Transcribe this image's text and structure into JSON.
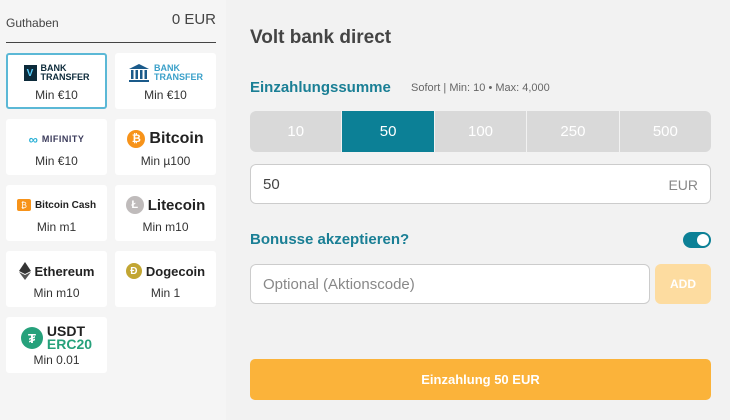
{
  "balance": {
    "label": "Guthaben",
    "amount": "0 EUR"
  },
  "methods": [
    {
      "id": "volt",
      "logo_line1": "BANK",
      "logo_line2": "TRANSFER",
      "min": "Min €10",
      "selected": true
    },
    {
      "id": "bank",
      "logo_line1": "BANK",
      "logo_line2": "TRANSFER",
      "min": "Min €10"
    },
    {
      "id": "mifinity",
      "logo": "MIFINITY",
      "min": "Min €10"
    },
    {
      "id": "bitcoin",
      "name": "Bitcoin",
      "min": "Min µ100"
    },
    {
      "id": "bitcoin-cash",
      "name": "Bitcoin Cash",
      "min": "Min m1"
    },
    {
      "id": "litecoin",
      "name": "Litecoin",
      "min": "Min m10"
    },
    {
      "id": "ethereum",
      "name": "Ethereum",
      "min": "Min m10"
    },
    {
      "id": "dogecoin",
      "name": "Dogecoin",
      "min": "Min 1"
    },
    {
      "id": "usdt",
      "name_line1": "USDT",
      "name_line2": "ERC20",
      "min": "Min 0.01"
    }
  ],
  "main": {
    "title": "Volt bank direct",
    "amount_section": {
      "label": "Einzahlungssumme",
      "info": "Sofort | Min: 10 • Max: 4,000"
    },
    "amount_options": [
      "10",
      "50",
      "100",
      "250",
      "500"
    ],
    "selected_amount": "50",
    "amount_input": {
      "value": "50",
      "currency": "EUR"
    },
    "bonus": {
      "label": "Bonusse akzeptieren?",
      "enabled": true
    },
    "promo": {
      "placeholder": "Optional (Aktionscode)",
      "add_label": "ADD"
    },
    "submit_label": "Einzahlung 50 EUR"
  },
  "colors": {
    "accent": "#0c8096",
    "submit": "#fbb33a",
    "heading": "#1a7f95"
  }
}
